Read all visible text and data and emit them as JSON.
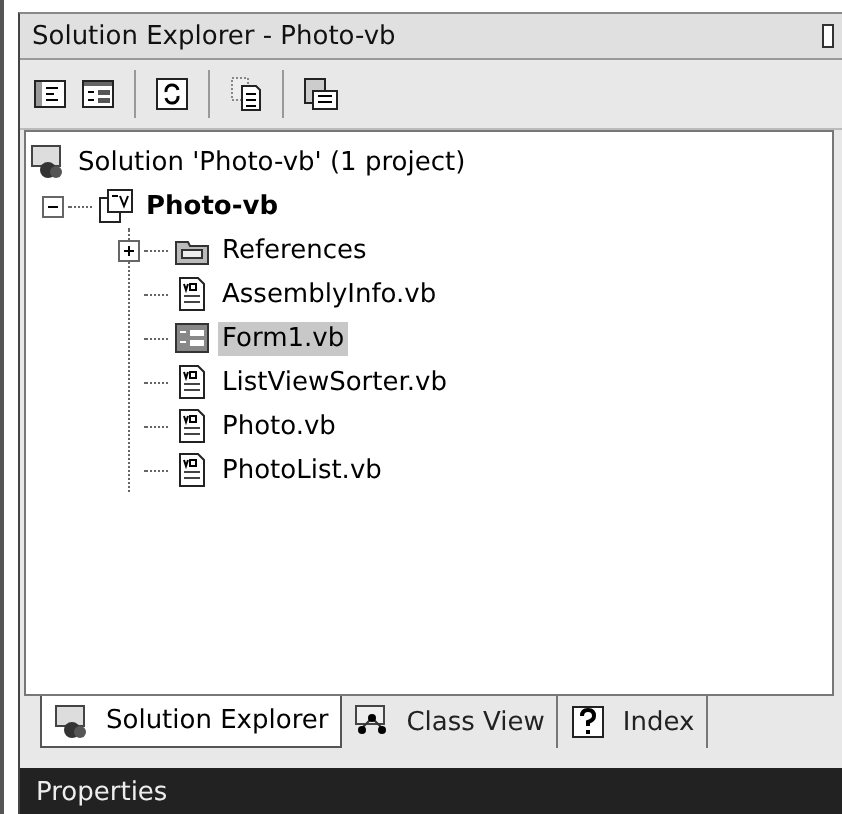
{
  "window": {
    "title": "Solution Explorer - Photo-vb"
  },
  "toolbar": [
    {
      "kind": "properties"
    },
    {
      "kind": "showall"
    },
    {
      "kind": "refresh"
    },
    {
      "kind": "code"
    },
    {
      "kind": "designer"
    }
  ],
  "tree": {
    "label": "Solution 'Photo-vb' (1 project)",
    "kind": "solution",
    "children": [
      {
        "label": "Photo-vb",
        "kind": "project",
        "expanded": true,
        "selected": false,
        "children": [
          {
            "label": "References",
            "kind": "references",
            "expanded": false,
            "selected": false
          },
          {
            "label": "AssemblyInfo.vb",
            "kind": "vbfile",
            "selected": false
          },
          {
            "label": "Form1.vb",
            "kind": "form",
            "selected": true
          },
          {
            "label": "ListViewSorter.vb",
            "kind": "vbfile",
            "selected": false
          },
          {
            "label": "Photo.vb",
            "kind": "vbfile",
            "selected": false
          },
          {
            "label": "PhotoList.vb",
            "kind": "vbfile",
            "selected": false
          }
        ]
      }
    ]
  },
  "tabs": [
    {
      "label": "Solution Explorer",
      "kind": "solution",
      "selected": true
    },
    {
      "label": "Class View",
      "kind": "classview",
      "selected": false
    },
    {
      "label": "Index",
      "kind": "help",
      "selected": false
    }
  ],
  "next_panel": {
    "title": "Properties"
  }
}
